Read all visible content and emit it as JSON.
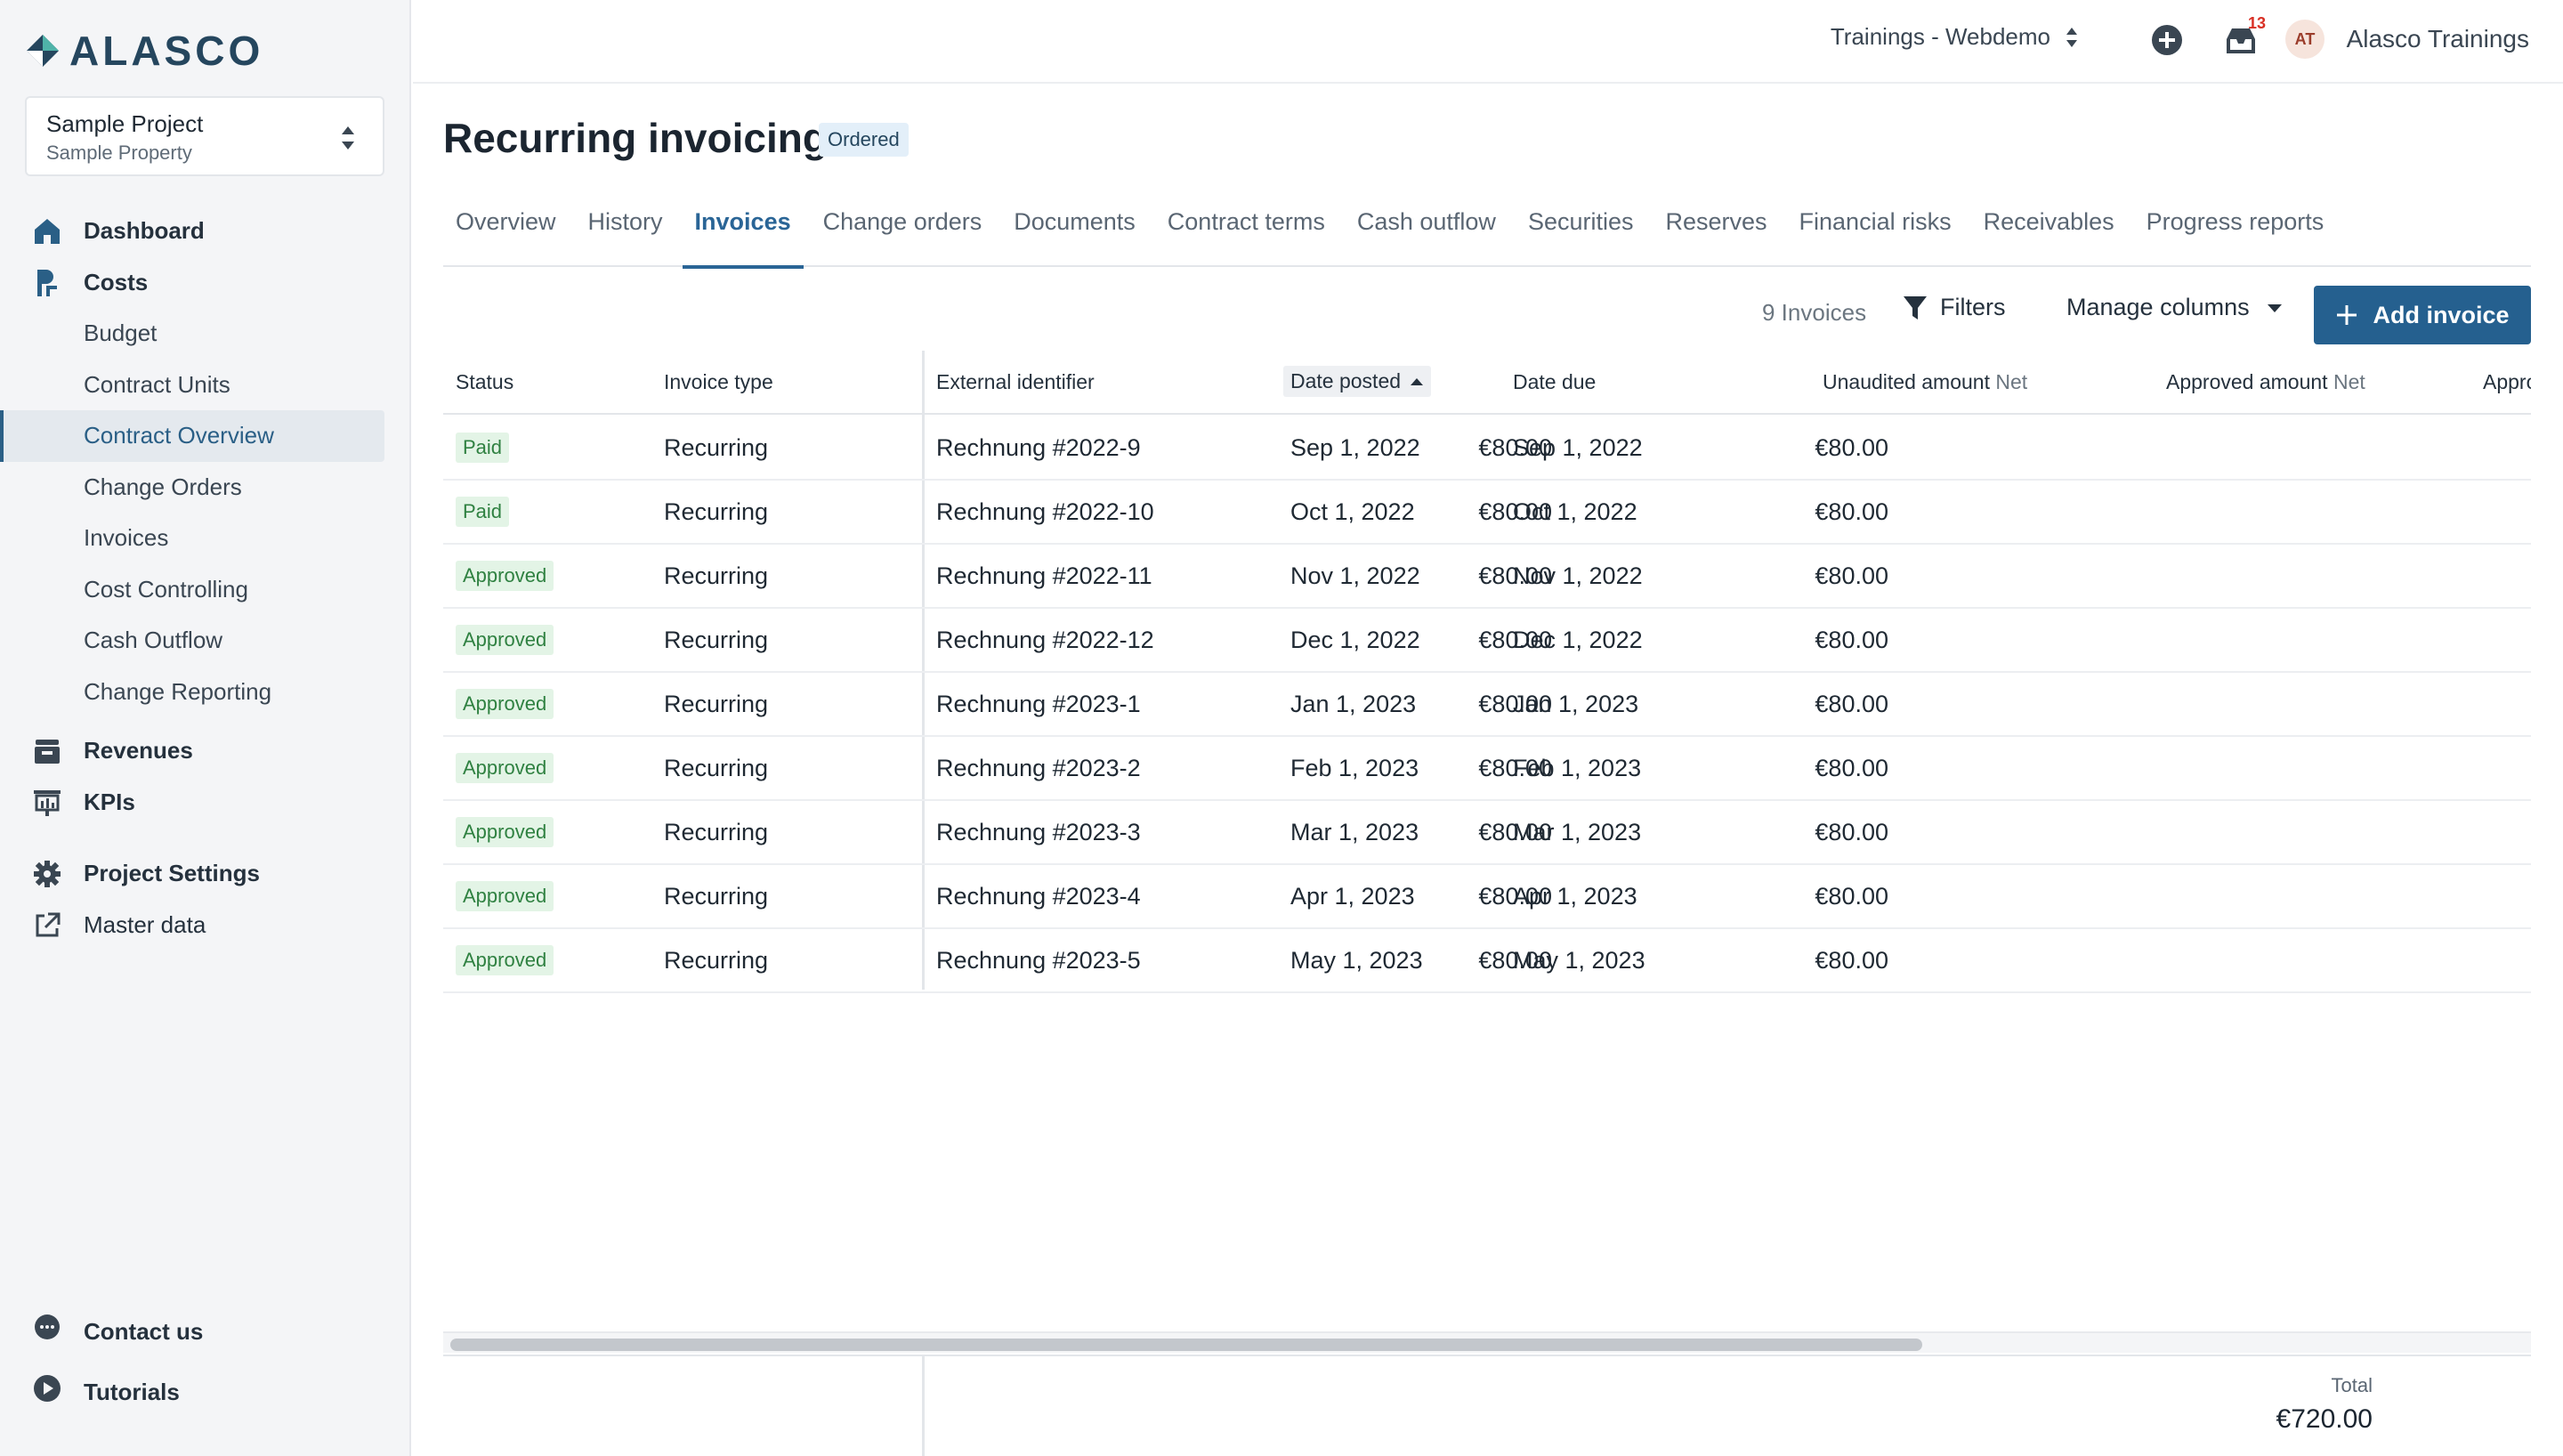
{
  "brand": {
    "name": "ALASCO"
  },
  "project": {
    "name": "Sample Project",
    "property": "Sample Property"
  },
  "sidebar": {
    "sections": {
      "dashboard": "Dashboard",
      "costs": "Costs",
      "revenues": "Revenues",
      "kpis": "KPIs",
      "project_settings": "Project Settings",
      "master_data": "Master data",
      "contact": "Contact us",
      "tutorials": "Tutorials"
    },
    "cost_items": [
      "Budget",
      "Contract Units",
      "Contract Overview",
      "Change Orders",
      "Invoices",
      "Cost Controlling",
      "Cash Outflow",
      "Change Reporting"
    ],
    "active_item": "Contract Overview"
  },
  "header": {
    "org": "Trainings - Webdemo",
    "notification_count": "13",
    "avatar_initials": "AT",
    "user": "Alasco Trainings"
  },
  "page": {
    "title": "Recurring invoicing",
    "status": "Ordered"
  },
  "tabs": [
    "Overview",
    "History",
    "Invoices",
    "Change orders",
    "Documents",
    "Contract terms",
    "Cash outflow",
    "Securities",
    "Reserves",
    "Financial risks",
    "Receivables",
    "Progress reports"
  ],
  "active_tab": "Invoices",
  "toolbar": {
    "count": "9 Invoices",
    "filters": "Filters",
    "manage_columns": "Manage columns",
    "add_invoice": "Add invoice"
  },
  "table": {
    "headers": {
      "status": "Status",
      "invoice_type": "Invoice type",
      "external_identifier": "External identifier",
      "date_posted": "Date posted",
      "date_due": "Date due",
      "unaudited_amount": "Unaudited amount",
      "unaudited_unit": "Net",
      "approved_amount": "Approved amount",
      "approved_unit": "Net",
      "approved_truncated": "Appro"
    },
    "rows": [
      {
        "status": "Paid",
        "type": "Recurring",
        "id": "Rechnung #2022-9",
        "posted": "Sep 1, 2022",
        "due": "Sep 1, 2022",
        "unaudited": "€80.00",
        "approved": "€80.00"
      },
      {
        "status": "Paid",
        "type": "Recurring",
        "id": "Rechnung #2022-10",
        "posted": "Oct 1, 2022",
        "due": "Oct 1, 2022",
        "unaudited": "€80.00",
        "approved": "€80.00"
      },
      {
        "status": "Approved",
        "type": "Recurring",
        "id": "Rechnung #2022-11",
        "posted": "Nov 1, 2022",
        "due": "Nov 1, 2022",
        "unaudited": "€80.00",
        "approved": "€80.00"
      },
      {
        "status": "Approved",
        "type": "Recurring",
        "id": "Rechnung #2022-12",
        "posted": "Dec 1, 2022",
        "due": "Dec 1, 2022",
        "unaudited": "€80.00",
        "approved": "€80.00"
      },
      {
        "status": "Approved",
        "type": "Recurring",
        "id": "Rechnung #2023-1",
        "posted": "Jan 1, 2023",
        "due": "Jan 1, 2023",
        "unaudited": "€80.00",
        "approved": "€80.00"
      },
      {
        "status": "Approved",
        "type": "Recurring",
        "id": "Rechnung #2023-2",
        "posted": "Feb 1, 2023",
        "due": "Feb 1, 2023",
        "unaudited": "€80.00",
        "approved": "€80.00"
      },
      {
        "status": "Approved",
        "type": "Recurring",
        "id": "Rechnung #2023-3",
        "posted": "Mar 1, 2023",
        "due": "Mar 1, 2023",
        "unaudited": "€80.00",
        "approved": "€80.00"
      },
      {
        "status": "Approved",
        "type": "Recurring",
        "id": "Rechnung #2023-4",
        "posted": "Apr 1, 2023",
        "due": "Apr 1, 2023",
        "unaudited": "€80.00",
        "approved": "€80.00"
      },
      {
        "status": "Approved",
        "type": "Recurring",
        "id": "Rechnung #2023-5",
        "posted": "May 1, 2023",
        "due": "May 1, 2023",
        "unaudited": "€80.00",
        "approved": "€80.00"
      }
    ]
  },
  "footer": {
    "total_label": "Total",
    "total_value": "€720.00"
  },
  "colors": {
    "accent": "#25608f",
    "brand": "#25465e",
    "paid_badge_bg": "#e3f4e6",
    "paid_badge_text": "#2f8141"
  }
}
